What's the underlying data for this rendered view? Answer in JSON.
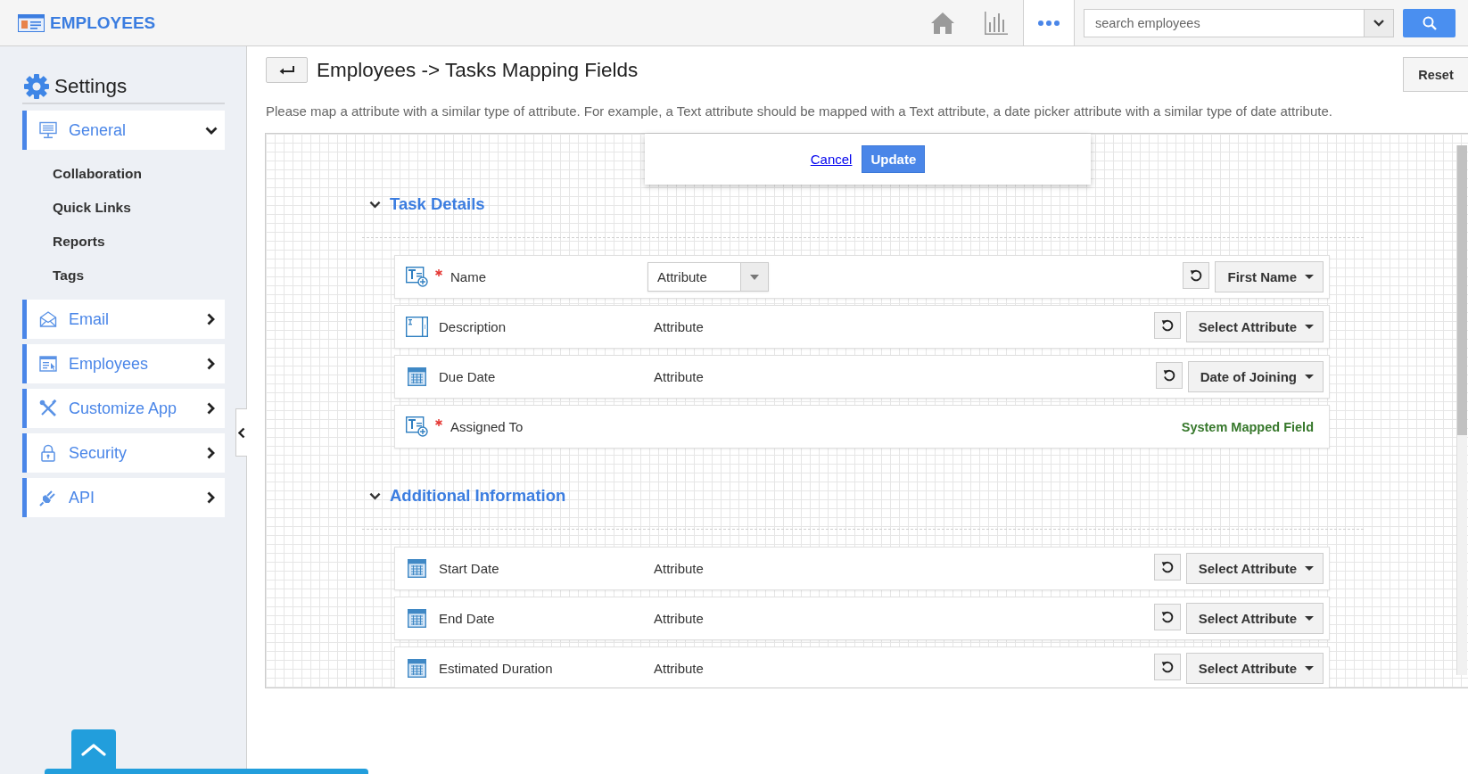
{
  "header": {
    "app_title": "EMPLOYEES",
    "nav": [
      {
        "kind": "home",
        "selected": false
      },
      {
        "kind": "reports",
        "selected": false
      },
      {
        "kind": "more",
        "selected": true
      }
    ],
    "search": {
      "placeholder": "search employees"
    }
  },
  "sidebar": {
    "title": "Settings",
    "items": [
      {
        "kind": "general",
        "label": "General",
        "expanded": true,
        "children": [
          {
            "label": "Collaboration"
          },
          {
            "label": "Quick Links"
          },
          {
            "label": "Reports"
          },
          {
            "label": "Tags"
          }
        ]
      },
      {
        "kind": "email",
        "label": "Email",
        "expanded": false
      },
      {
        "kind": "employees",
        "label": "Employees",
        "expanded": false
      },
      {
        "kind": "customize",
        "label": "Customize App",
        "expanded": false
      },
      {
        "kind": "security",
        "label": "Security",
        "expanded": false
      },
      {
        "kind": "api",
        "label": "API",
        "expanded": false
      }
    ]
  },
  "page": {
    "title": "Employees -> Tasks Mapping Fields",
    "reset": "Reset",
    "description": "Please map a attribute with a similar type of attribute. For example, a Text attribute should be mapped with a Text attribute, a date picker attribute with a similar type of date attribute."
  },
  "update_bar": {
    "cancel": "Cancel",
    "update": "Update"
  },
  "sections": [
    {
      "title": "Task Details",
      "expanded": true,
      "rows": [
        {
          "kind": "text",
          "required": true,
          "label": "Name",
          "attribute": {
            "kind": "dropdown",
            "value": "Attribute"
          },
          "mapping": {
            "kind": "select",
            "value": "First Name"
          }
        },
        {
          "kind": "textarea",
          "required": false,
          "label": "Description",
          "attribute": {
            "kind": "plain",
            "value": "Attribute"
          },
          "mapping": {
            "kind": "select",
            "value": "Select Attribute"
          }
        },
        {
          "kind": "date",
          "required": false,
          "label": "Due Date",
          "attribute": {
            "kind": "plain",
            "value": "Attribute"
          },
          "mapping": {
            "kind": "select",
            "value": "Date of Joining"
          }
        },
        {
          "kind": "text",
          "required": true,
          "label": "Assigned To",
          "mapping": {
            "kind": "system",
            "value": "System Mapped Field"
          }
        }
      ]
    },
    {
      "title": "Additional Information",
      "expanded": true,
      "rows": [
        {
          "kind": "date",
          "required": false,
          "label": "Start Date",
          "attribute": {
            "kind": "plain",
            "value": "Attribute"
          },
          "mapping": {
            "kind": "select",
            "value": "Select Attribute"
          }
        },
        {
          "kind": "date",
          "required": false,
          "label": "End Date",
          "attribute": {
            "kind": "plain",
            "value": "Attribute"
          },
          "mapping": {
            "kind": "select",
            "value": "Select Attribute"
          }
        },
        {
          "kind": "date",
          "required": false,
          "label": "Estimated Duration",
          "attribute": {
            "kind": "plain",
            "value": "Attribute"
          },
          "mapping": {
            "kind": "select",
            "value": "Select Attribute"
          }
        }
      ]
    }
  ]
}
